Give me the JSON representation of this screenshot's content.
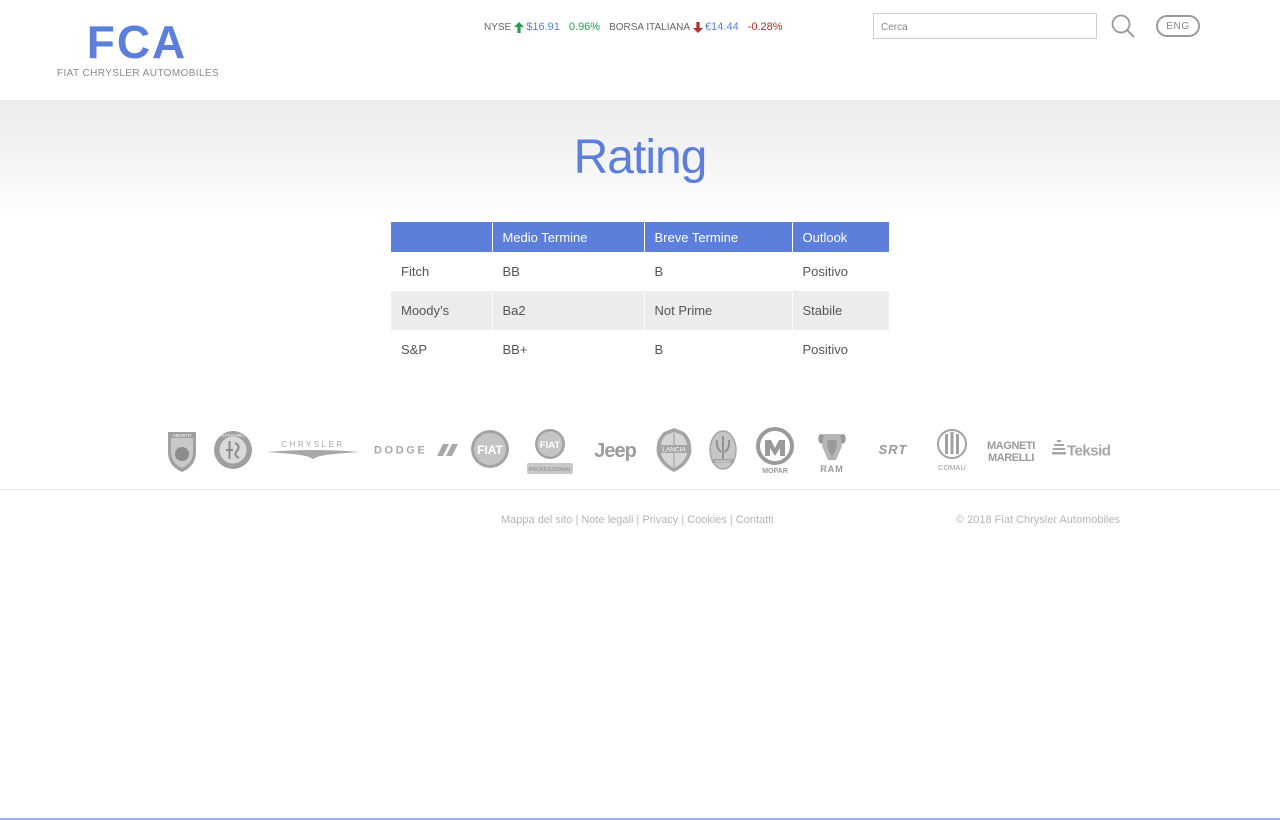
{
  "header": {
    "logo_mark": "FCA",
    "logo_text": "FIAT CHRYSLER AUTOMOBILES",
    "tickers": [
      {
        "exchange": "NYSE",
        "direction": "up",
        "price": "$16.91",
        "change": "0.96%"
      },
      {
        "exchange": "BORSA ITALIANA",
        "direction": "down",
        "price": "€14.44",
        "change": "-0.28%"
      }
    ],
    "search": {
      "placeholder": "Cerca",
      "value": ""
    },
    "lang_label": "ENG"
  },
  "page": {
    "title": "Rating"
  },
  "table": {
    "headers": [
      "",
      "Medio Termine",
      "Breve Termine",
      "Outlook"
    ],
    "rows": [
      [
        "Fitch",
        "BB",
        "B",
        "Positivo"
      ],
      [
        "Moody’s",
        "Ba2",
        "Not Prime",
        "Stabile"
      ],
      [
        "S&P",
        "BB+",
        "B",
        "Positivo"
      ]
    ]
  },
  "brands": [
    {
      "id": "abarth",
      "label": "ABARTH"
    },
    {
      "id": "alfa-romeo",
      "label": "ALFA ROMEO"
    },
    {
      "id": "chrysler",
      "label": "CHRYSLER"
    },
    {
      "id": "dodge",
      "label": "DODGE"
    },
    {
      "id": "fiat",
      "label": "FIAT"
    },
    {
      "id": "fiat-professional",
      "label": "FIAT",
      "sublabel": "PROFESSIONAL"
    },
    {
      "id": "jeep",
      "label": "Jeep"
    },
    {
      "id": "lancia",
      "label": "LANCIA"
    },
    {
      "id": "maserati",
      "label": "MASERATI"
    },
    {
      "id": "mopar",
      "label": "MOPAR"
    },
    {
      "id": "ram",
      "label": "RAM"
    },
    {
      "id": "srt",
      "label": "SRT"
    },
    {
      "id": "comau",
      "label": "COMAU"
    },
    {
      "id": "magneti-marelli",
      "label": "MAGNETI",
      "label2": "MARELLI"
    },
    {
      "id": "teksid",
      "label": "Teksid"
    }
  ],
  "footer": {
    "links": [
      "Mappa del sito",
      "Note legali",
      "Privacy",
      "Cookies",
      "Contatti"
    ],
    "separator": "|",
    "copyright": "© 2018 Fiat Chrysler Automobiles"
  },
  "colors": {
    "accent": "#5b7fdb",
    "up": "#2a9a4a",
    "down": "#b03030",
    "brand_gray": "#9b9b9b"
  },
  "icons": {
    "search": "magnifier-icon",
    "up": "arrow-up-icon",
    "down": "arrow-down-icon"
  }
}
